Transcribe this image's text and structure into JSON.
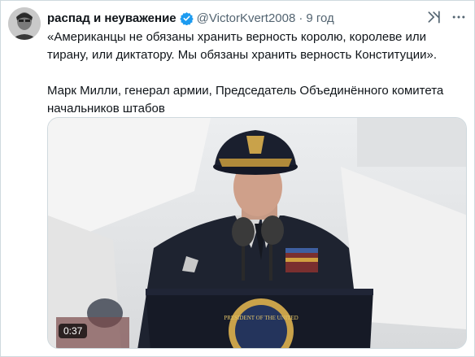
{
  "tweet": {
    "display_name": "распад и неуважение",
    "handle": "@VictorKvert2008",
    "separator": "·",
    "time": "9 год",
    "text": "«Американцы не обязаны хранить верность королю, королеве или тиранy, или диктатору. Мы обязаны хранить верность Конституции».\n\nМарк Милли, генерал армии, Председатель Объединённого комитета начальников штабов",
    "media": {
      "duration": "0:37",
      "seal_text": "PRESIDENT OF THE UNITED"
    },
    "icons": {
      "verified": "verified-badge-icon",
      "grok": "grok-icon",
      "more": "more-icon"
    },
    "colors": {
      "verified": "#1d9bf0",
      "secondary_text": "#536471"
    }
  }
}
